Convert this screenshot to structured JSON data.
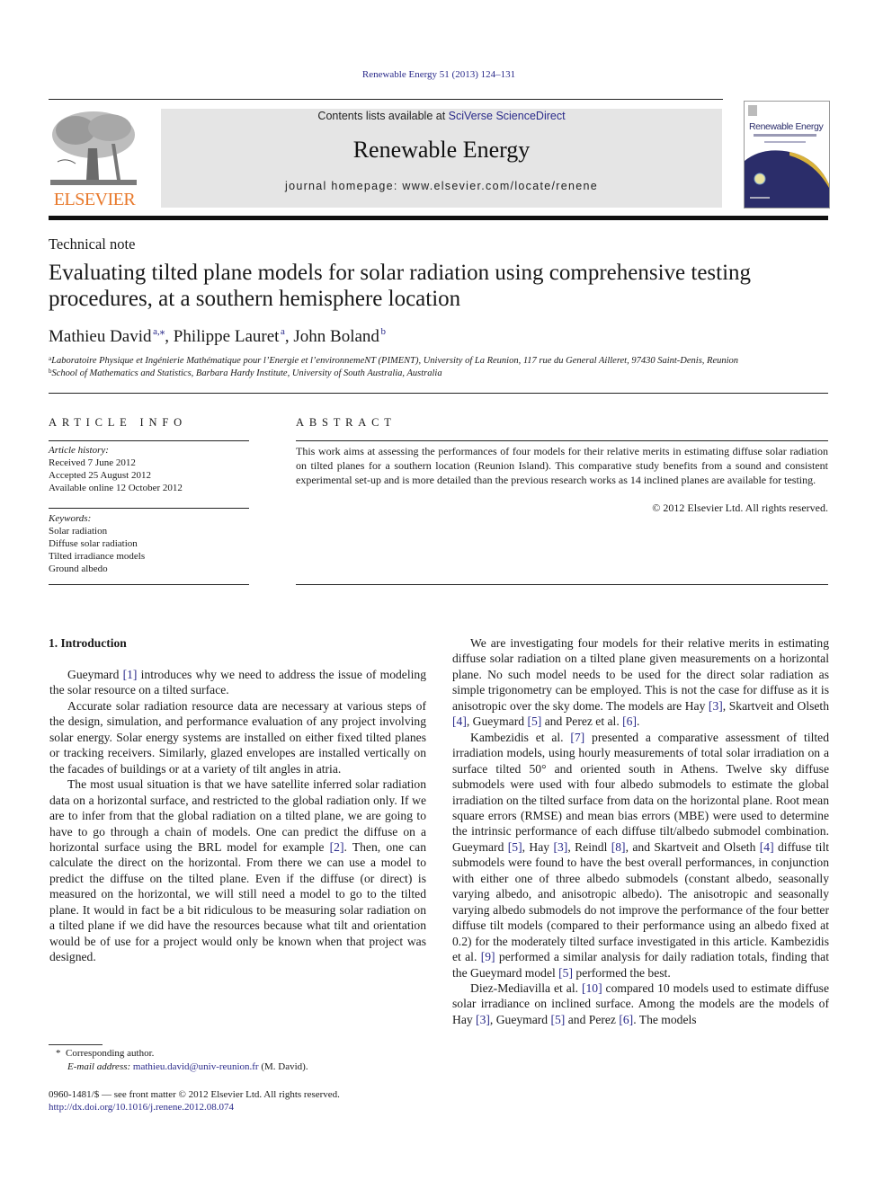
{
  "header": {
    "citation": "Renewable Energy 51 (2013) 124–131",
    "contents_prefix": "Contents lists available at ",
    "contents_link": "SciVerse ScienceDirect",
    "journal_title": "Renewable Energy",
    "homepage": "journal homepage: www.elsevier.com/locate/renene",
    "publisher_logo_text": "ELSEVIER",
    "cover_title": "Renewable Energy",
    "colors": {
      "elsevier_orange": "#e8782a",
      "link_blue": "#2a2a8a",
      "banner_gray": "#e5e5e5",
      "cover_navy": "#2b2d6a",
      "cover_gold": "#d9b23a"
    }
  },
  "article": {
    "type": "Technical note",
    "title": "Evaluating tilted plane models for solar radiation using comprehensive testing procedures, at a southern hemisphere location",
    "authors": [
      {
        "name": "Mathieu David",
        "sup": "a,⁎"
      },
      {
        "name": "Philippe Lauret",
        "sup": "a"
      },
      {
        "name": "John Boland",
        "sup": "b"
      }
    ],
    "affiliations": [
      {
        "label": "a",
        "text": "Laboratoire Physique et Ingénierie Mathématique pour l’Energie et l’environnemeNT (PIMENT), University of La Reunion, 117 rue du General Ailleret, 97430 Saint-Denis, Reunion"
      },
      {
        "label": "b",
        "text": "School of Mathematics and Statistics, Barbara Hardy Institute, University of South Australia, Australia"
      }
    ]
  },
  "article_info": {
    "heading": "ARTICLE INFO",
    "history_label": "Article history:",
    "history": [
      "Received 7 June 2012",
      "Accepted 25 August 2012",
      "Available online 12 October 2012"
    ],
    "keywords_label": "Keywords:",
    "keywords": [
      "Solar radiation",
      "Diffuse solar radiation",
      "Tilted irradiance models",
      "Ground albedo"
    ]
  },
  "abstract": {
    "heading": "ABSTRACT",
    "text": "This work aims at assessing the performances of four models for their relative merits in estimating diffuse solar radiation on tilted planes for a southern location (Reunion Island). This comparative study benefits from a sound and consistent experimental set-up and is more detailed than the previous research works as 14 inclined planes are available for testing.",
    "copyright": "© 2012 Elsevier Ltd. All rights reserved."
  },
  "body": {
    "section_heading": "1.  Introduction",
    "left_paragraphs": [
      [
        {
          "t": "Gueymard "
        },
        {
          "c": "[1]"
        },
        {
          "t": " introduces why we need to address the issue of modeling the solar resource on a tilted surface."
        }
      ],
      [
        {
          "t": "Accurate solar radiation resource data are necessary at various steps of the design, simulation, and performance evaluation of any project involving solar energy. Solar energy systems are installed on either fixed tilted planes or tracking receivers. Similarly, glazed envelopes are installed vertically on the facades of buildings or at a variety of tilt angles in atria."
        }
      ],
      [
        {
          "t": "The most usual situation is that we have satellite inferred solar radiation data on a horizontal surface, and restricted to the global radiation only. If we are to infer from that the global radiation on a tilted plane, we are going to have to go through a chain of models. One can predict the diffuse on a horizontal surface using the BRL model for example "
        },
        {
          "c": "[2]"
        },
        {
          "t": ". Then, one can calculate the direct on the horizontal. From there we can use a model to predict the diffuse on the tilted plane. Even if the diffuse (or direct) is measured on the horizontal, we will still need a model to go to the tilted plane. It would in fact be a bit ridiculous to be measuring solar radiation on a tilted plane if we did have the resources because what tilt and orientation would be of use for a project would only be known when that project was designed."
        }
      ]
    ],
    "right_paragraphs": [
      [
        {
          "t": "We are investigating four models for their relative merits in estimating diffuse solar radiation on a tilted plane given measurements on a horizontal plane. No such model needs to be used for the direct solar radiation as simple trigonometry can be employed. This is not the case for diffuse as it is anisotropic over the sky dome. The models are Hay "
        },
        {
          "c": "[3]"
        },
        {
          "t": ", Skartveit and Olseth "
        },
        {
          "c": "[4]"
        },
        {
          "t": ", Gueymard "
        },
        {
          "c": "[5]"
        },
        {
          "t": " and Perez et al. "
        },
        {
          "c": "[6]"
        },
        {
          "t": "."
        }
      ],
      [
        {
          "t": "Kambezidis et al. "
        },
        {
          "c": "[7]"
        },
        {
          "t": " presented a comparative assessment of tilted irradiation models, using hourly measurements of total solar irradiation on a surface tilted 50° and oriented south in Athens. Twelve sky diffuse submodels were used with four albedo submodels to estimate the global irradiation on the tilted surface from data on the horizontal plane. Root mean square errors (RMSE) and mean bias errors (MBE) were used to determine the intrinsic performance of each diffuse tilt/albedo submodel combination. Gueymard "
        },
        {
          "c": "[5]"
        },
        {
          "t": ", Hay "
        },
        {
          "c": "[3]"
        },
        {
          "t": ", Reindl "
        },
        {
          "c": "[8]"
        },
        {
          "t": ", and Skartveit and Olseth "
        },
        {
          "c": "[4]"
        },
        {
          "t": " diffuse tilt submodels were found to have the best overall performances, in conjunction with either one of three albedo submodels (constant albedo, seasonally varying albedo, and anisotropic albedo). The anisotropic and seasonally varying albedo submodels do not improve the performance of the four better diffuse tilt models (compared to their performance using an albedo fixed at 0.2) for the moderately tilted surface investigated in this article. Kambezidis et al. "
        },
        {
          "c": "[9]"
        },
        {
          "t": " performed a similar analysis for daily radiation totals, finding that the Gueymard model "
        },
        {
          "c": "[5]"
        },
        {
          "t": " performed the best."
        }
      ],
      [
        {
          "t": "Diez-Mediavilla et al. "
        },
        {
          "c": "[10]"
        },
        {
          "t": " compared 10 models used to estimate diffuse solar irradiance on inclined surface. Among the models are the models of Hay "
        },
        {
          "c": "[3]"
        },
        {
          "t": ", Gueymard "
        },
        {
          "c": "[5]"
        },
        {
          "t": " and Perez "
        },
        {
          "c": "[6]"
        },
        {
          "t": ". The models"
        }
      ]
    ]
  },
  "footnotes": {
    "corresponding_mark": "*",
    "corresponding": "Corresponding author.",
    "email_label": "E-mail address:",
    "email": "mathieu.david@univ-reunion.fr",
    "email_suffix": " (M. David).",
    "front_matter": "0960-1481/$ — see front matter © 2012 Elsevier Ltd. All rights reserved.",
    "doi": "http://dx.doi.org/10.1016/j.renene.2012.08.074"
  }
}
